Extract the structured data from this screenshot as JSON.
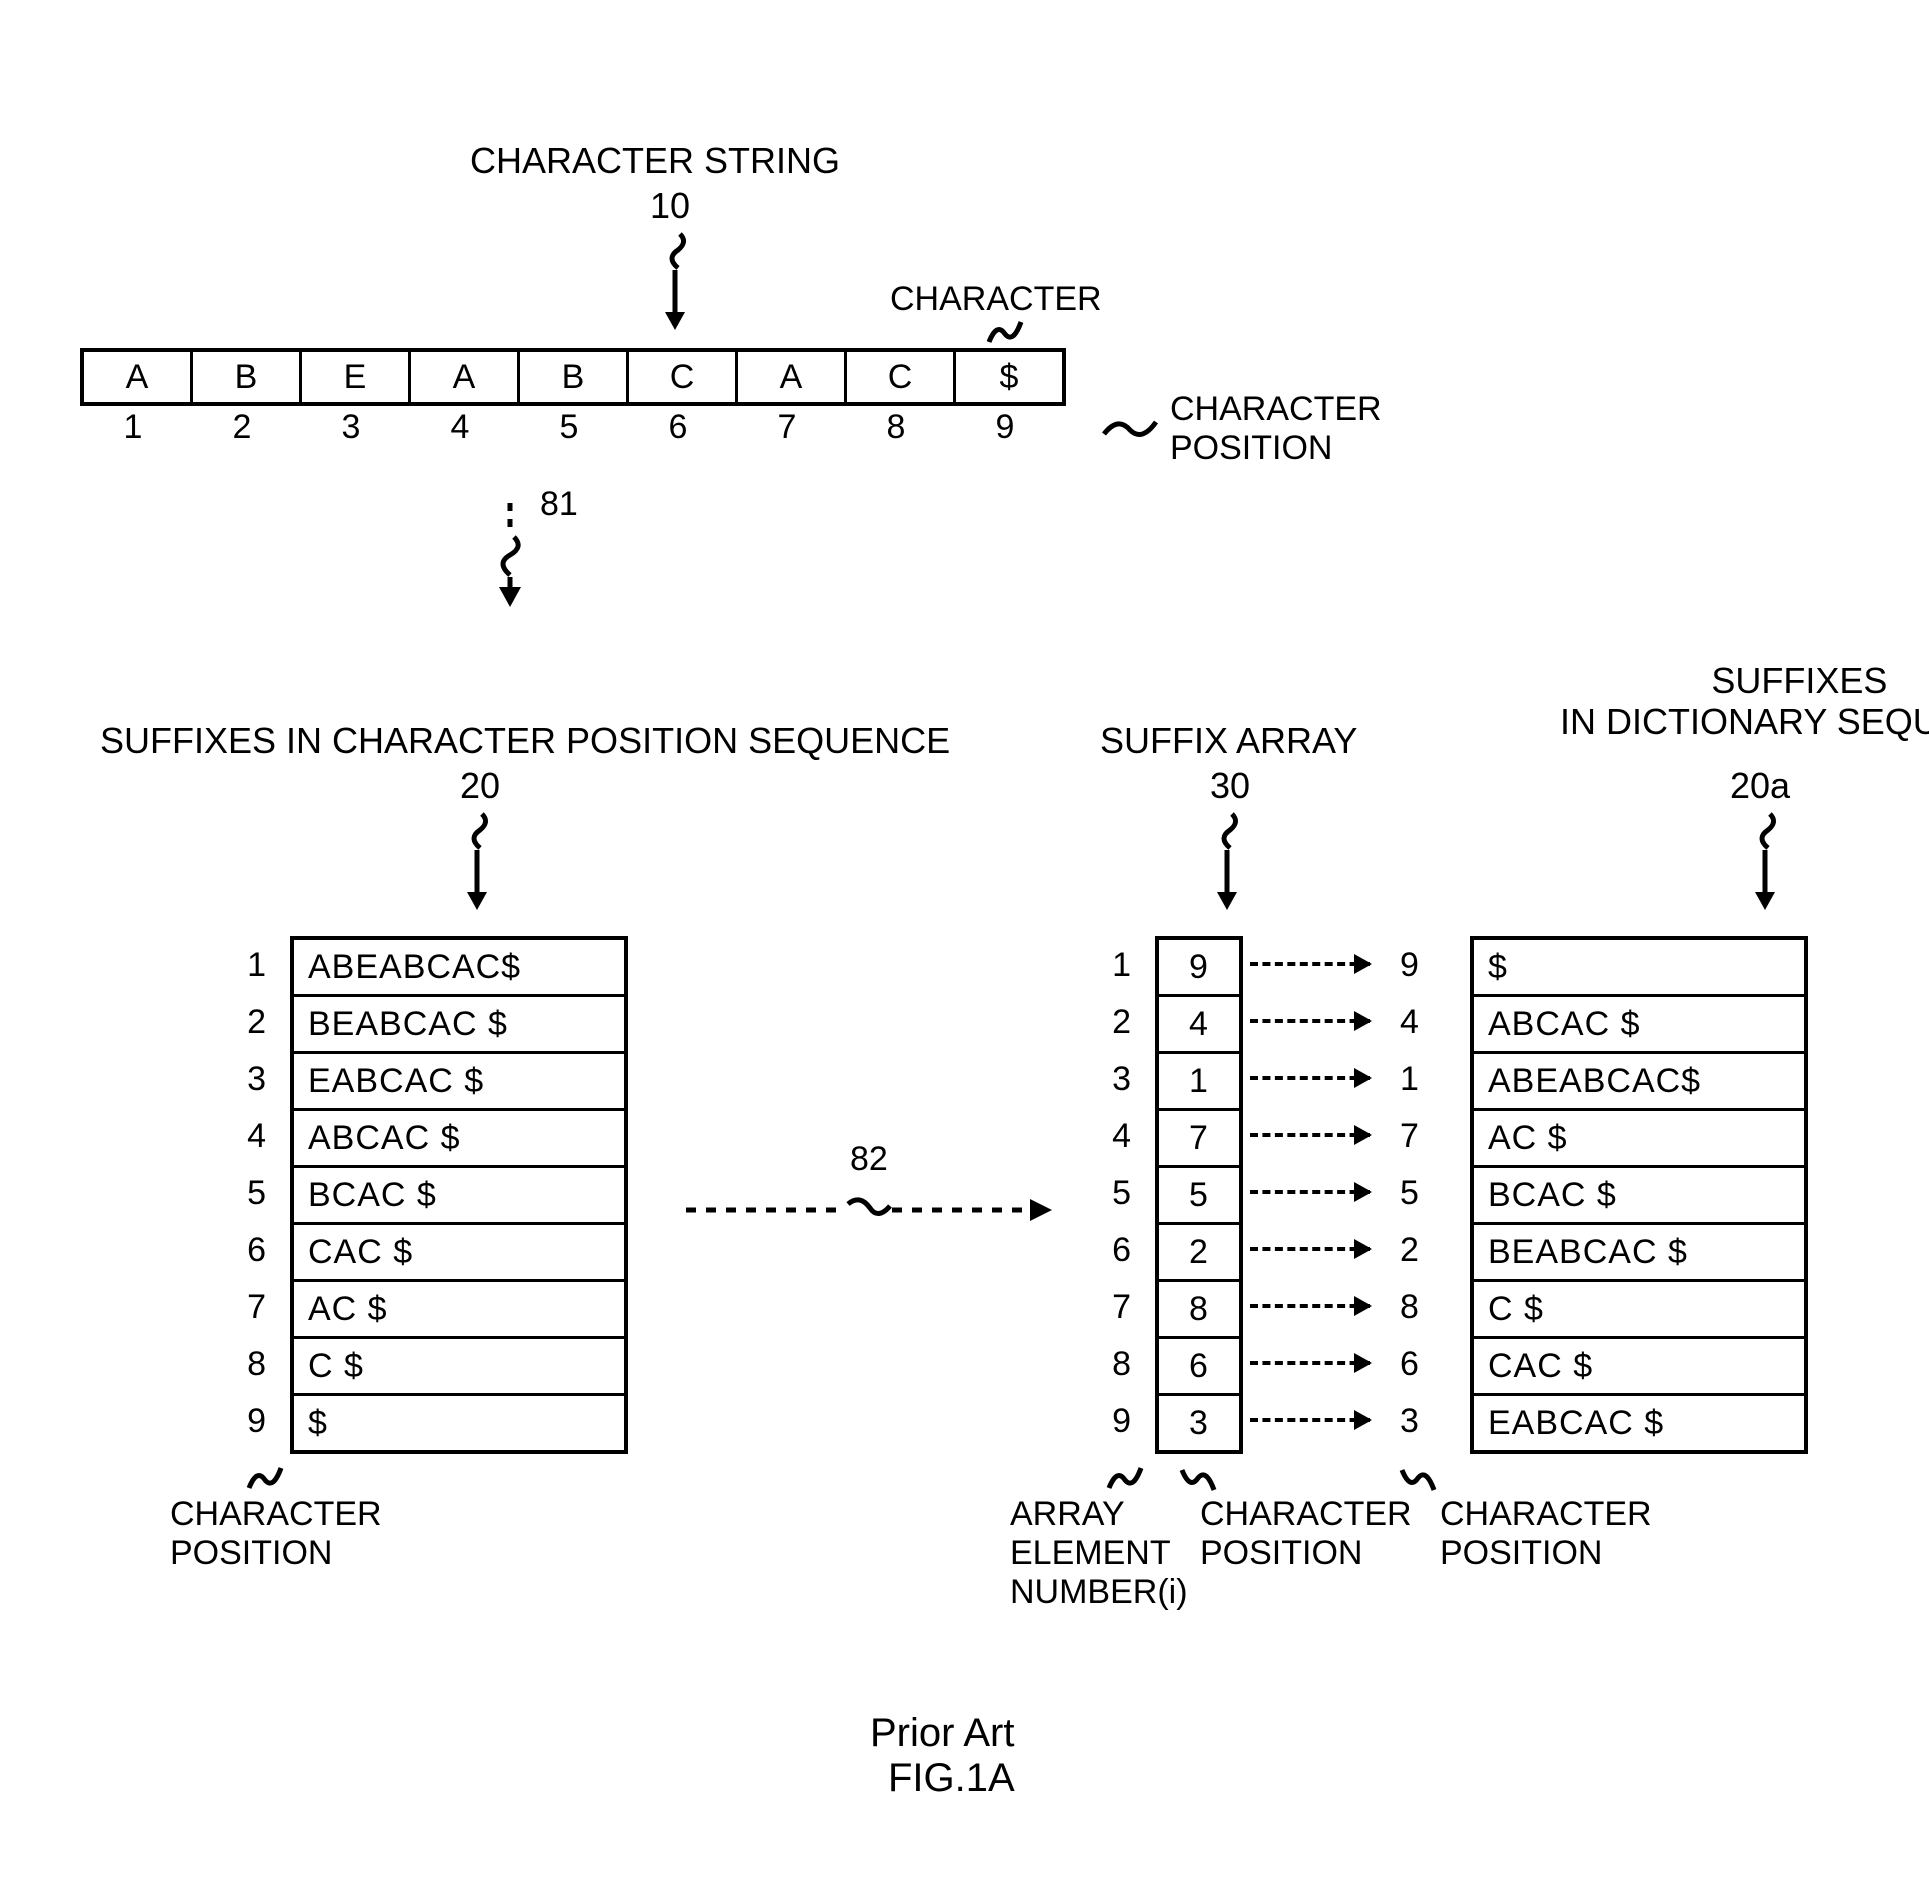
{
  "labels": {
    "char_string_title": "CHARACTER STRING",
    "char_string_ref": "10",
    "character_word": "CHARACTER",
    "char_position_side": "CHARACTER\nPOSITION",
    "trans_81": "81",
    "suffixes_pos_title": "SUFFIXES IN CHARACTER POSITION SEQUENCE",
    "suffixes_pos_ref": "20",
    "char_position_bottom_left": "CHARACTER\nPOSITION",
    "trans_82": "82",
    "suffix_array_title": "SUFFIX ARRAY",
    "suffix_array_ref": "30",
    "suffix_dict_title": "SUFFIXES\nIN DICTIONARY SEQUENCE",
    "suffix_dict_ref": "20a",
    "array_elem_num": "ARRAY\nELEMENT\nNUMBER(i)",
    "char_pos_mid": "CHARACTER\nPOSITION",
    "char_pos_right": "CHARACTER\nPOSITION",
    "prior_art": "Prior Art",
    "fig": "FIG.1A"
  },
  "char_string": {
    "cells": [
      "A",
      "B",
      "E",
      "A",
      "B",
      "C",
      "A",
      "C",
      "$"
    ],
    "positions": [
      "1",
      "2",
      "3",
      "4",
      "5",
      "6",
      "7",
      "8",
      "9"
    ]
  },
  "suffixes_pos": {
    "idx": [
      "1",
      "2",
      "3",
      "4",
      "5",
      "6",
      "7",
      "8",
      "9"
    ],
    "rows": [
      "ABEABCAC$",
      "BEABCAC $",
      "EABCAC $",
      "ABCAC $",
      "BCAC $",
      "CAC $",
      "AC $",
      "C $",
      "$"
    ]
  },
  "suffix_array": {
    "idx": [
      "1",
      "2",
      "3",
      "4",
      "5",
      "6",
      "7",
      "8",
      "9"
    ],
    "vals": [
      "9",
      "4",
      "1",
      "7",
      "5",
      "2",
      "8",
      "6",
      "3"
    ]
  },
  "bridge": [
    "9",
    "4",
    "1",
    "7",
    "5",
    "2",
    "8",
    "6",
    "3"
  ],
  "suffixes_dict": {
    "rows": [
      "$",
      "ABCAC $",
      "ABEABCAC$",
      "AC $",
      "BCAC $",
      "BEABCAC $",
      "C $",
      "CAC $",
      "EABCAC $"
    ]
  }
}
